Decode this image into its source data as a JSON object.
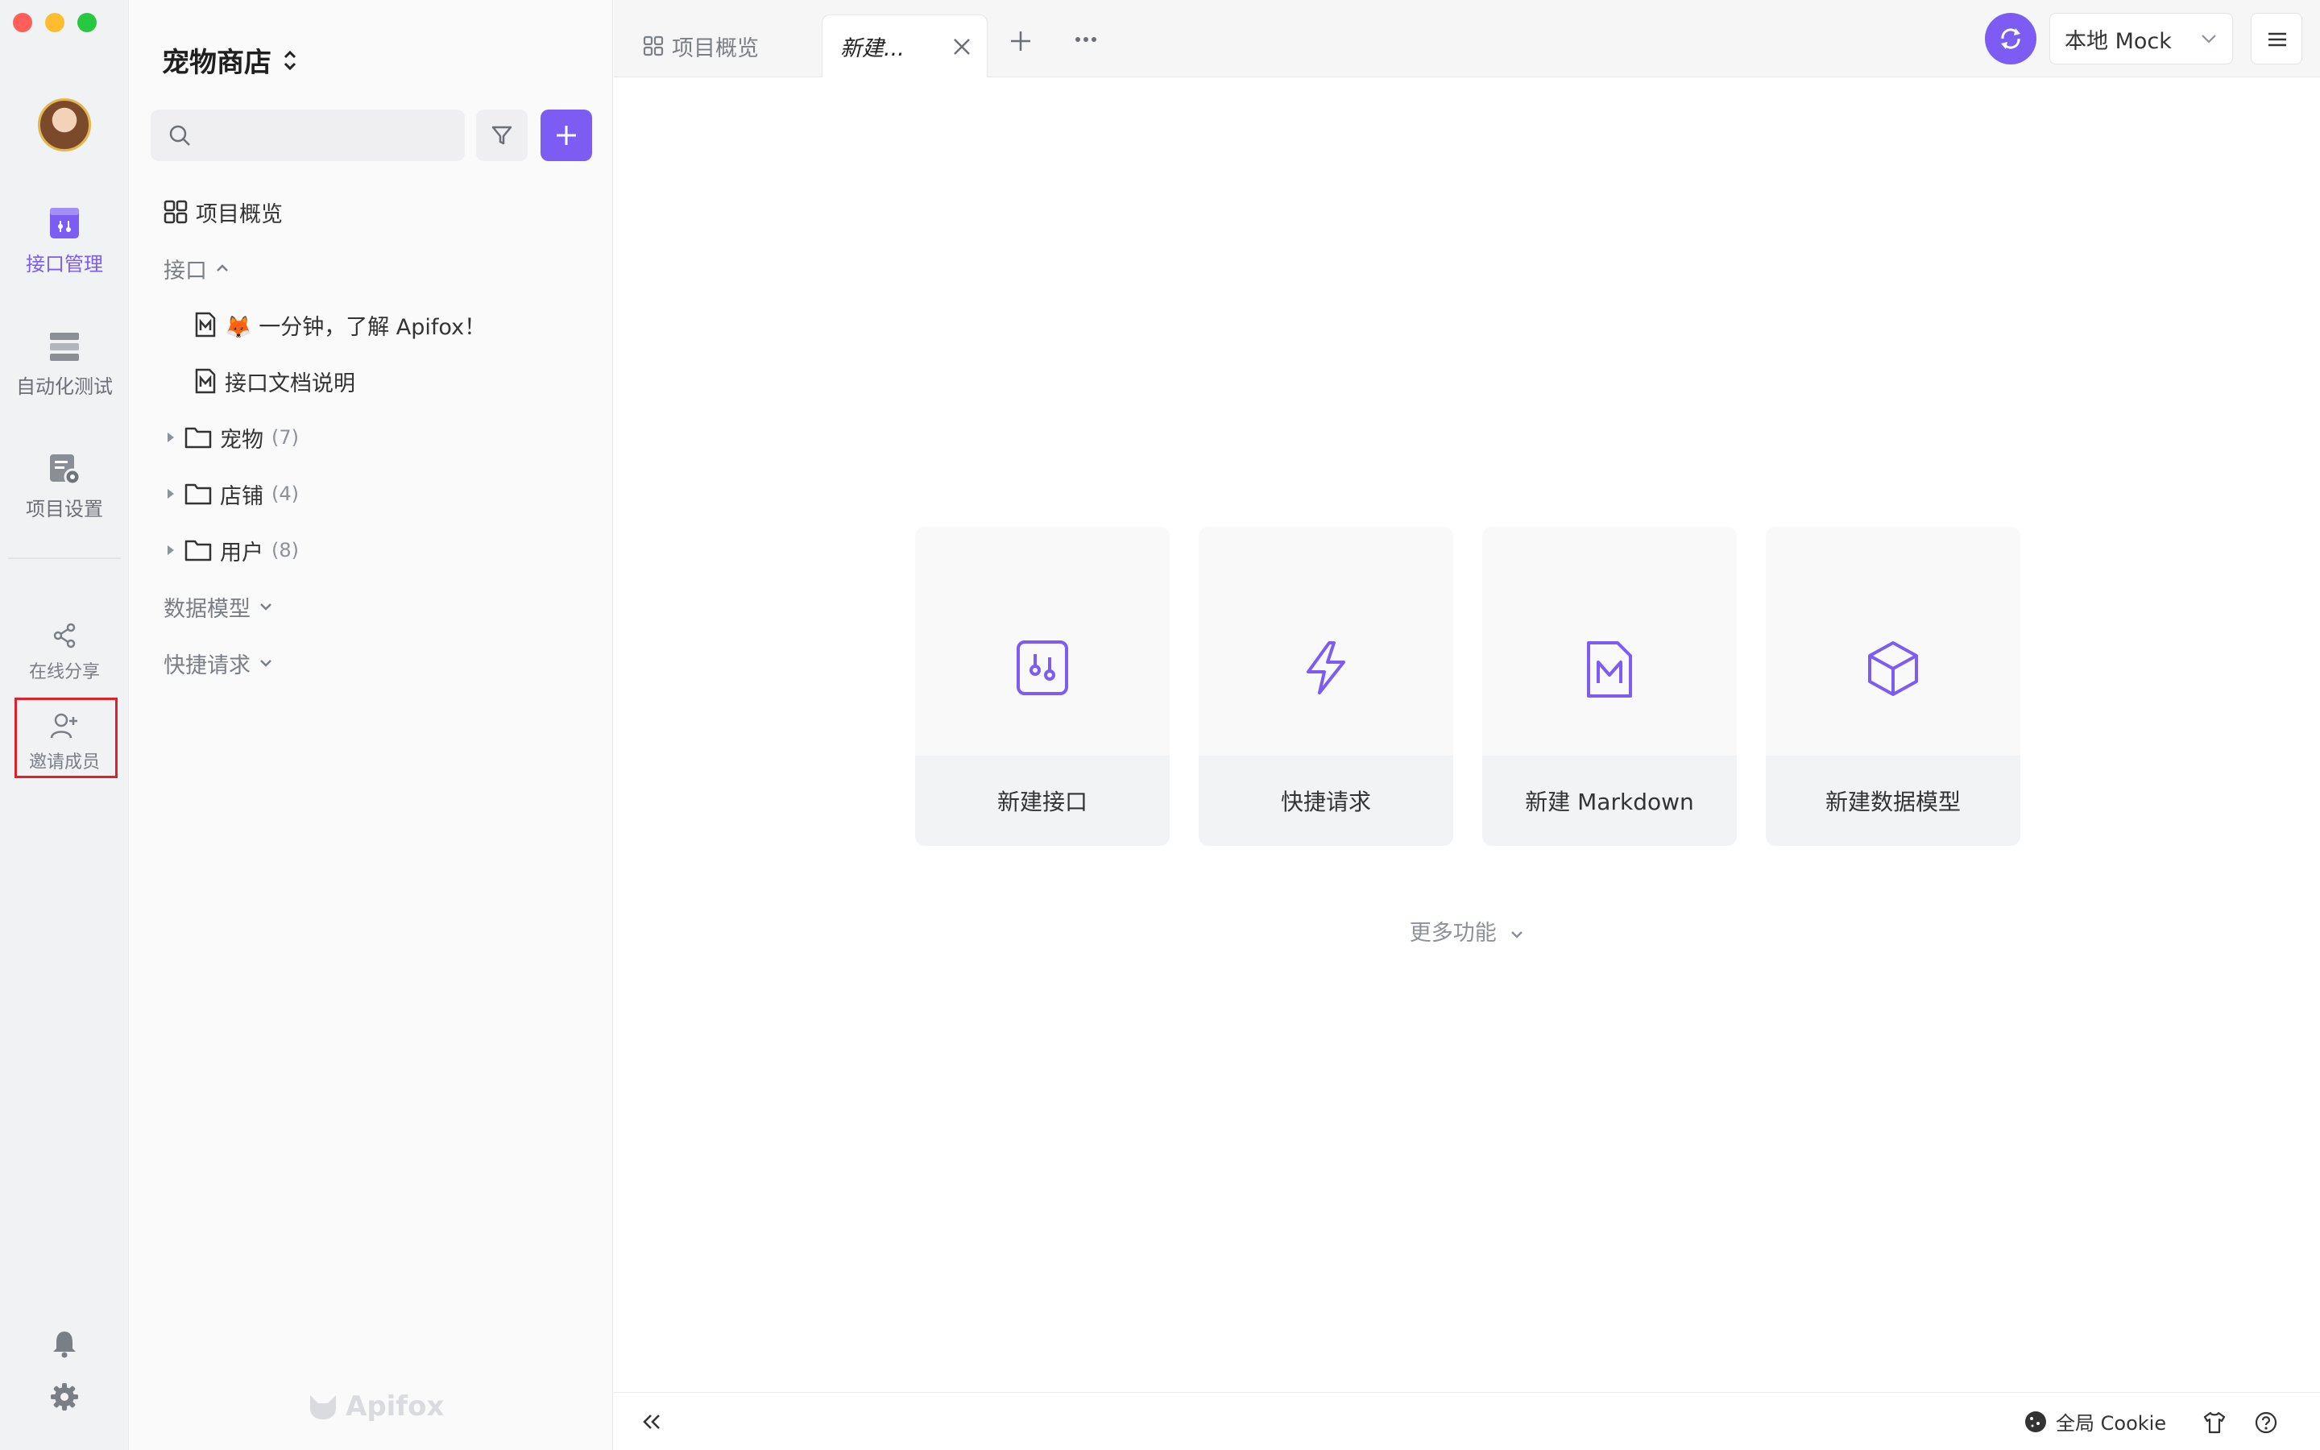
{
  "colors": {
    "accent": "#7c5cf3",
    "highlight": "#e0202a"
  },
  "rail": {
    "items": [
      {
        "label": "接口管理",
        "icon": "api-manage-icon",
        "active": true
      },
      {
        "label": "自动化测试",
        "icon": "auto-test-icon"
      },
      {
        "label": "项目设置",
        "icon": "project-settings-icon"
      },
      {
        "label": "在线分享",
        "icon": "share-icon"
      },
      {
        "label": "邀请成员",
        "icon": "invite-member-icon"
      }
    ],
    "bottom": [
      {
        "icon": "bell-icon"
      },
      {
        "icon": "gear-icon"
      }
    ]
  },
  "sidebar": {
    "project_name": "宠物商店",
    "search_placeholder": "",
    "overview": "项目概览",
    "api_section": "接口",
    "docs": [
      {
        "label": "🦊 一分钟，了解 Apifox！"
      },
      {
        "label": "接口文档说明"
      }
    ],
    "folders": [
      {
        "name": "宠物",
        "count": "(7)"
      },
      {
        "name": "店铺",
        "count": "(4)"
      },
      {
        "name": "用户",
        "count": "(8)"
      }
    ],
    "schemas_section": "数据模型",
    "quick_section": "快捷请求",
    "watermark": "Apifox"
  },
  "tabs": {
    "overview": "项目概览",
    "active": "新建..."
  },
  "toolbar": {
    "env": "本地 Mock"
  },
  "cards": [
    {
      "label": "新建接口",
      "icon": "api-icon"
    },
    {
      "label": "快捷请求",
      "icon": "lightning-icon"
    },
    {
      "label": "新建 Markdown",
      "icon": "markdown-icon"
    },
    {
      "label": "新建数据模型",
      "icon": "cube-icon"
    }
  ],
  "more": "更多功能",
  "status": {
    "cookie": "全局 Cookie"
  }
}
